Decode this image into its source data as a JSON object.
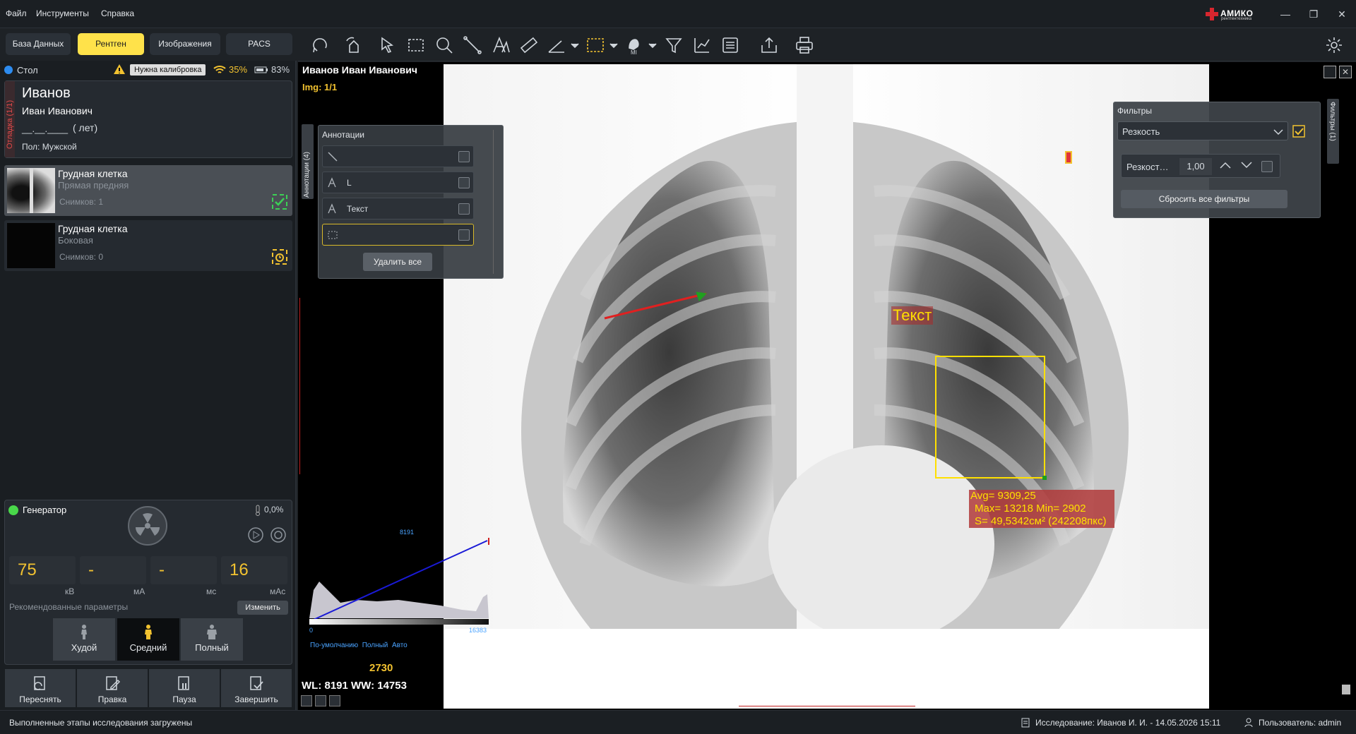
{
  "app": {
    "logo_text": "АМИКО",
    "logo_sub": "рентгентехника"
  },
  "menu": [
    "Файл",
    "Инструменты",
    "Справка"
  ],
  "tabs": [
    "База Данных",
    "Рентген",
    "Изображения",
    "PACS"
  ],
  "device": {
    "name": "Стол",
    "calibration": "Нужна калибровка",
    "wifi": "35%",
    "battery": "83%"
  },
  "patient": {
    "vertical_tab": "Отладка (1/1)",
    "last_name": "Иванов",
    "first_names": "Иван Иванович",
    "dob": "__.__.____",
    "age": "(  лет)",
    "sex": "Пол: Мужской"
  },
  "studies": [
    {
      "title": "Грудная клетка",
      "sub": "Прямая предняя",
      "count": "Снимков: 1"
    },
    {
      "title": "Грудная клетка",
      "sub": "Боковая",
      "count": "Снимков: 0"
    }
  ],
  "generator": {
    "title": "Генератор",
    "temp": "0,0%",
    "kv": "75",
    "ma": "-",
    "ms": "-",
    "mas": "16",
    "kv_unit": "кВ",
    "ma_unit": "мА",
    "ms_unit": "мс",
    "mas_unit": "мАс",
    "recommended": "Рекомендованные параметры",
    "change": "Изменить",
    "body": [
      "Худой",
      "Средний",
      "Полный"
    ],
    "actions": [
      "Переснять",
      "Правка",
      "Пауза",
      "Завершить"
    ]
  },
  "viewer": {
    "patient_name": "Иванов Иван Иванович",
    "img": "Img: 1/1",
    "annotations_tab": "Аннотации (4)",
    "annotations_title": "Аннотации",
    "annotation_rows": [
      "",
      "L",
      "Текст",
      ""
    ],
    "delete_all": "Удалить все",
    "text_annotation": "Текст",
    "roi": {
      "avg": "Avg= 9309,25",
      "maxmin": "Max= 13218 Min= 2902",
      "area": "S= 49,5342см² (242208пкс)"
    },
    "histogram": {
      "center": "8191",
      "min": "0",
      "max": "16383",
      "modes": "По-умолчанию  Полный  Авто",
      "value": "2730"
    },
    "wlww": "WL: 8191 WW: 14753",
    "filters_tab": "Фильтры (1)",
    "filters_title": "Фильтры",
    "filter_selected": "Резкость",
    "filter_param": "Резкост…",
    "filter_value": "1,00",
    "reset_filters": "Сбросить все фильтры"
  },
  "status": {
    "left": "Выполненные этапы исследования загружены",
    "study": "Исследование: Иванов И. И. - 14.05.2026 15:11",
    "user": "Пользователь: admin"
  },
  "colors": {
    "accent": "#ffe24a",
    "annotation_yellow": "#ffe000",
    "annotation_red": "#e02020",
    "roi_label_bg": "#b23a3a"
  }
}
